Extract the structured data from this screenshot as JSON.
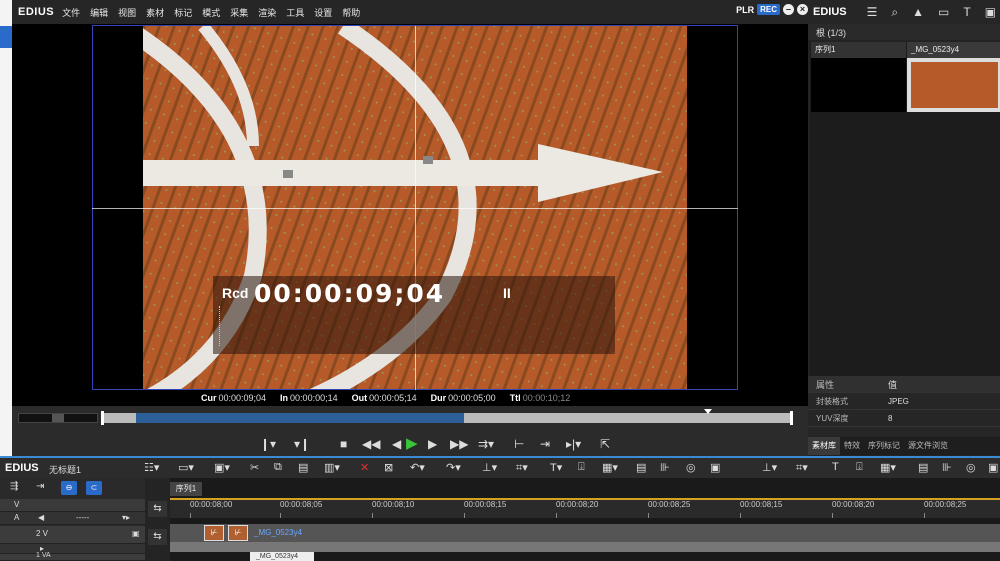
{
  "app": {
    "name": "EDIUS"
  },
  "menu": [
    "文件",
    "编辑",
    "视图",
    "素材",
    "标记",
    "模式",
    "采集",
    "渲染",
    "工具",
    "设置",
    "帮助"
  ],
  "mode": {
    "plr": "PLR",
    "rec": "REC"
  },
  "osd": {
    "rcd_label": "Rcd",
    "timecode": "00:00:09;04",
    "pause": "II"
  },
  "timecodes": {
    "cur_label": "Cur",
    "cur": "00:00:09;04",
    "in_label": "In",
    "in": "00:00:00;14",
    "out_label": "Out",
    "out": "00:00:05;14",
    "dur_label": "Dur",
    "dur": "00:00:05;00",
    "ttl_label": "Ttl",
    "ttl": "00:00:10;12"
  },
  "bin": {
    "title": "EDIUS",
    "root": "根 (1/3)",
    "clips": [
      {
        "name": "序列1",
        "type": "sequence"
      },
      {
        "name": "_MG_0523y4",
        "type": "still"
      }
    ]
  },
  "properties": {
    "header_key": "属性",
    "header_val": "值",
    "rows": [
      {
        "k": "封装格式",
        "v": "JPEG"
      },
      {
        "k": "YUV深度",
        "v": "8"
      }
    ]
  },
  "panel_tabs": [
    "素材库",
    "特效",
    "序列标记",
    "源文件浏览"
  ],
  "timeline": {
    "app": "EDIUS",
    "project": "无标题1",
    "sequence_tab": "序列1",
    "ruler": [
      "00:00:08;00",
      "00:00:08;05",
      "00:00:08;10",
      "00:00:08;15",
      "00:00:08;20",
      "00:00:08;25",
      "00:00:08;15",
      "00:00:08;20",
      "00:00:08;25"
    ],
    "tracks": [
      {
        "name": "V"
      },
      {
        "name": "A"
      },
      {
        "name": "2 V"
      },
      {
        "name": "1 VA"
      }
    ],
    "dash": "-----",
    "clip_name": "_MG_0523y4",
    "tooltip": "_MG_0523y4"
  },
  "colors": {
    "accent": "#2a6ac9",
    "play": "#39c43a",
    "ruler_line": "#d8a020"
  }
}
